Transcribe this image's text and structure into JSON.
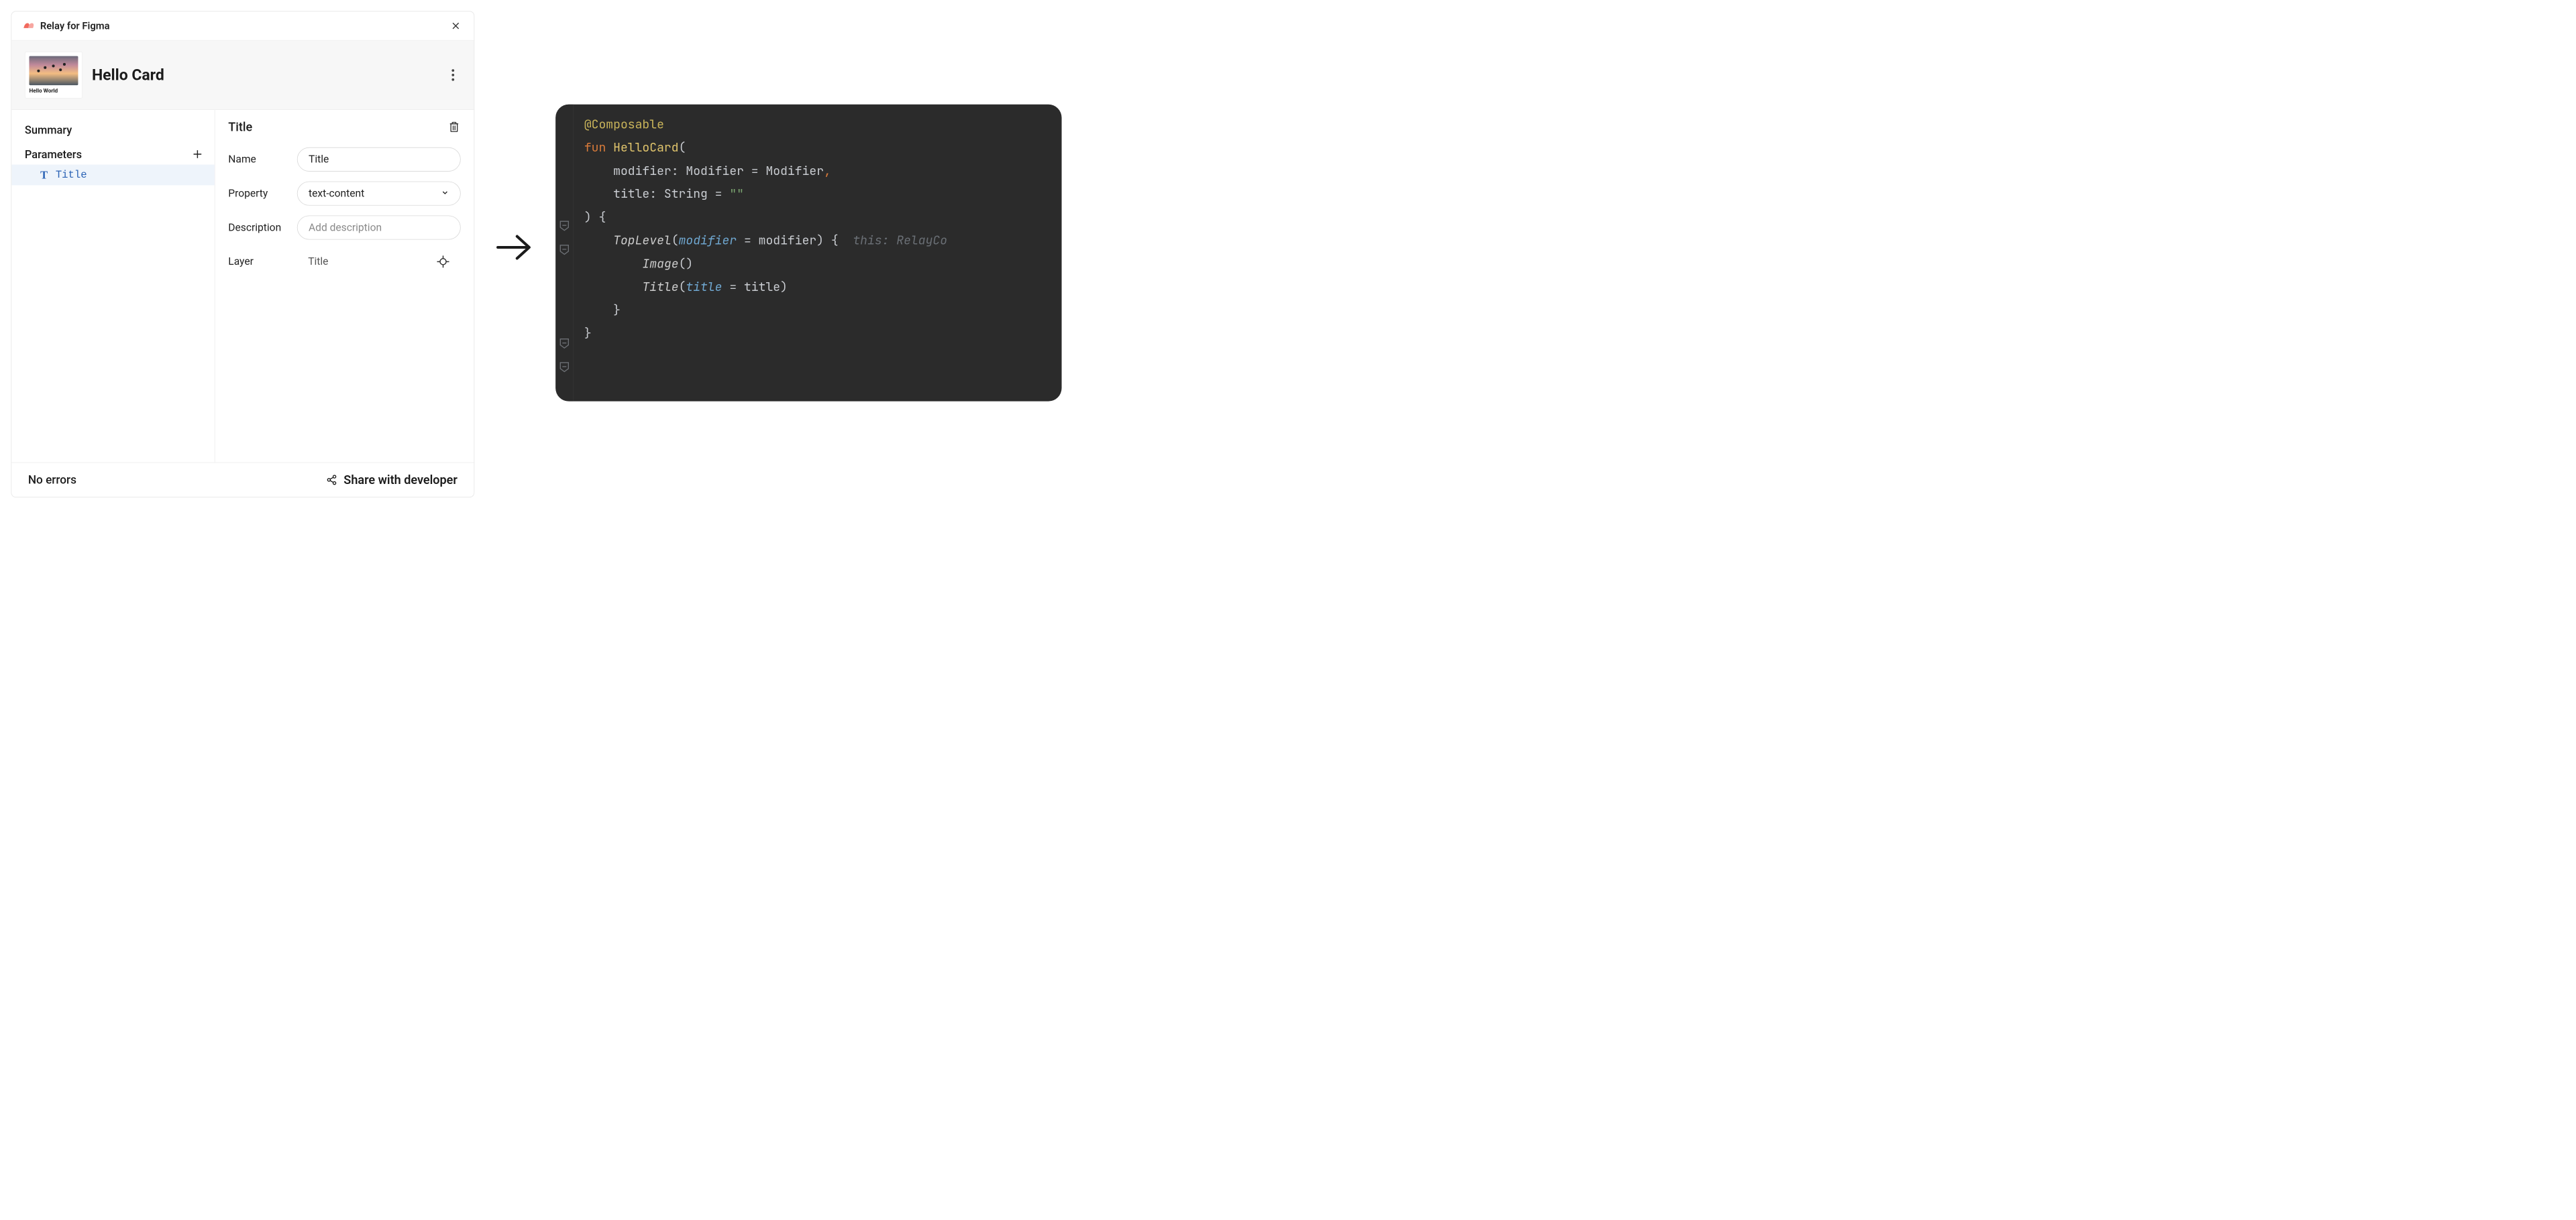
{
  "titlebar": {
    "title": "Relay for Figma"
  },
  "card": {
    "title": "Hello Card",
    "thumb_label": "Hello World"
  },
  "sidebar": {
    "summary_label": "Summary",
    "parameters_label": "Parameters",
    "params": [
      {
        "name": "Title"
      }
    ]
  },
  "detail": {
    "title": "Title",
    "fields": {
      "name_label": "Name",
      "name_value": "Title",
      "property_label": "Property",
      "property_value": "text-content",
      "description_label": "Description",
      "description_placeholder": "Add description",
      "layer_label": "Layer",
      "layer_value": "Title"
    }
  },
  "footer": {
    "status": "No errors",
    "share_label": "Share with developer"
  },
  "icons": {
    "close": "close-icon",
    "more": "more-vert-icon",
    "add": "add-icon",
    "delete": "trash-icon",
    "chevron_down": "chevron-down-icon",
    "target": "target-icon",
    "share": "share-icon",
    "text": "text-icon",
    "arrow": "arrow-right-icon"
  },
  "code": {
    "annotation": "@Composable",
    "fun_kw": "fun",
    "fn_name": "HelloCard",
    "mod_param": "modifier",
    "mod_type": "Modifier",
    "mod_default": "Modifier",
    "title_param": "title",
    "string_type": "String",
    "string_default": "\"\"",
    "top_level": "TopLevel",
    "image_call": "Image",
    "title_call": "Title",
    "hint": "this: RelayCo"
  }
}
